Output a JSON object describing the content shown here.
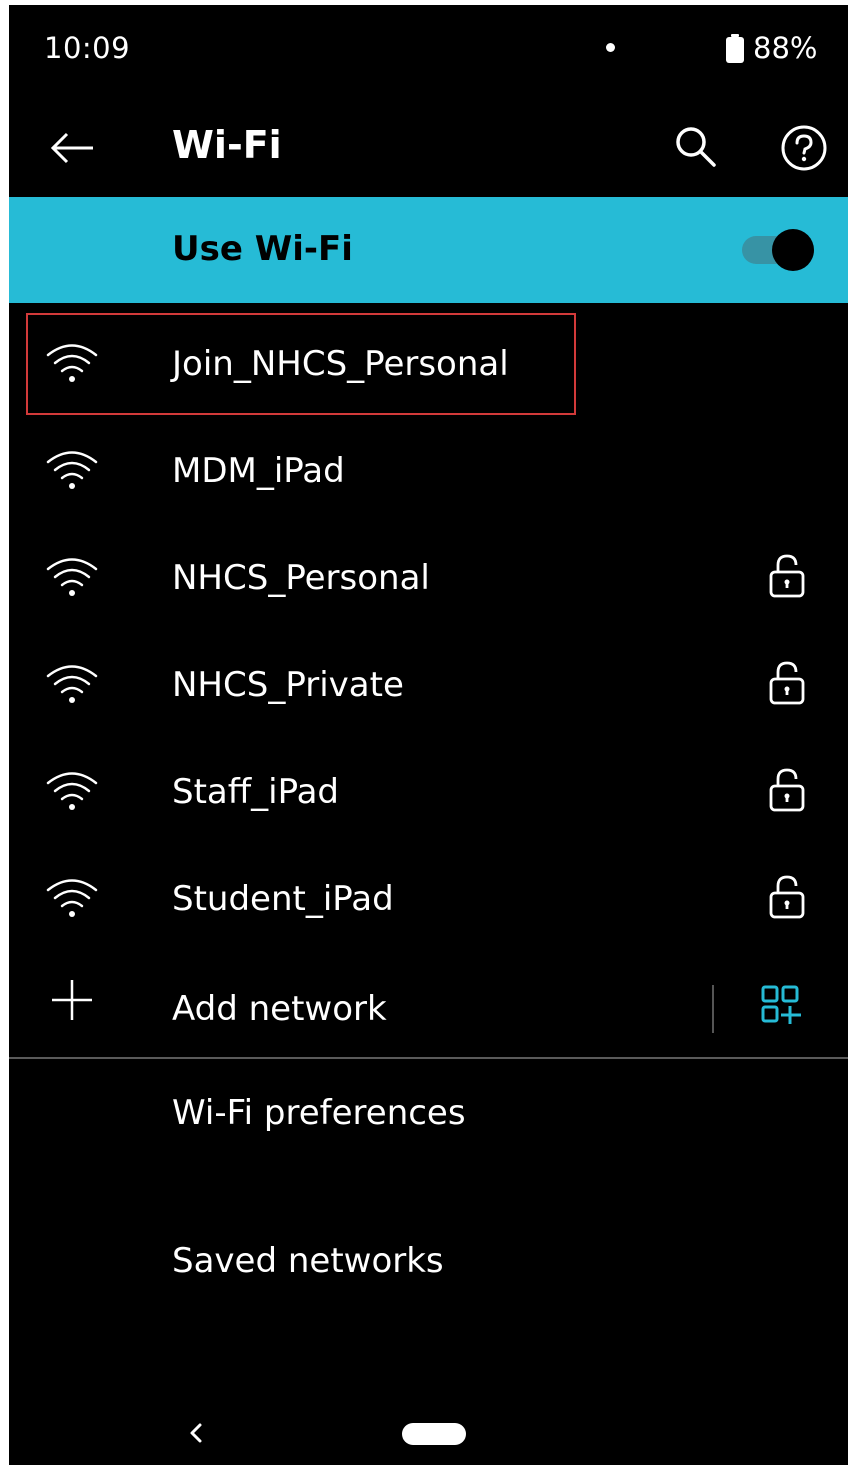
{
  "status_bar": {
    "time": "10:09",
    "battery": "88%"
  },
  "app_bar": {
    "title": "Wi-Fi",
    "icons": [
      "back-arrow-icon",
      "search-icon",
      "help-icon"
    ]
  },
  "use_wifi": {
    "label": "Use Wi-Fi",
    "enabled": true,
    "accent_color": "#26bbd6"
  },
  "networks": [
    {
      "name": "Join_NHCS_Personal",
      "locked": false,
      "highlighted": true
    },
    {
      "name": "MDM_iPad",
      "locked": false,
      "highlighted": false
    },
    {
      "name": "NHCS_Personal",
      "locked": true,
      "highlighted": false
    },
    {
      "name": "NHCS_Private",
      "locked": true,
      "highlighted": false
    },
    {
      "name": "Staff_iPad",
      "locked": true,
      "highlighted": false
    },
    {
      "name": "Student_iPad",
      "locked": true,
      "highlighted": false
    }
  ],
  "add_network": {
    "label": "Add network",
    "icon": "plus-icon",
    "scan_icon": "qr-code-icon"
  },
  "preferences": {
    "wifi_preferences_label": "Wi-Fi preferences",
    "saved_networks_label": "Saved networks"
  },
  "highlight_color": "#d23a3a"
}
